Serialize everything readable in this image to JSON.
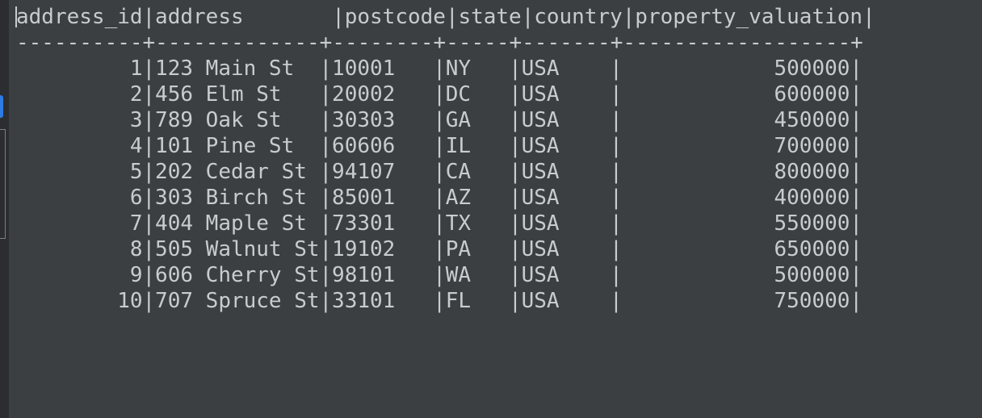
{
  "terminal": {
    "table": {
      "columns": [
        "address_id",
        "address",
        "postcode",
        "state",
        "country",
        "property_valuation"
      ],
      "separator": "----------+-------------+--------+-----+-------+------------------+",
      "rows": [
        [
          "1",
          "123 Main St",
          "10001",
          "NY",
          "USA",
          "500000"
        ],
        [
          "2",
          "456 Elm St",
          "20002",
          "DC",
          "USA",
          "600000"
        ],
        [
          "3",
          "789 Oak St",
          "30303",
          "GA",
          "USA",
          "450000"
        ],
        [
          "4",
          "101 Pine St",
          "60606",
          "IL",
          "USA",
          "700000"
        ],
        [
          "5",
          "202 Cedar St",
          "94107",
          "CA",
          "USA",
          "800000"
        ],
        [
          "6",
          "303 Birch St",
          "85001",
          "AZ",
          "USA",
          "400000"
        ],
        [
          "7",
          "404 Maple St",
          "73301",
          "TX",
          "USA",
          "550000"
        ],
        [
          "8",
          "505 Walnut St",
          "19102",
          "PA",
          "USA",
          "650000"
        ],
        [
          "9",
          "606 Cherry St",
          "98101",
          "WA",
          "USA",
          "500000"
        ],
        [
          "10",
          "707 Spruce St",
          "33101",
          "FL",
          "USA",
          "750000"
        ]
      ]
    }
  },
  "colors": {
    "background": "#3b3f42",
    "text": "#c8ccd0",
    "gutter": "#2b2d30",
    "accent": "#2f7be3"
  }
}
